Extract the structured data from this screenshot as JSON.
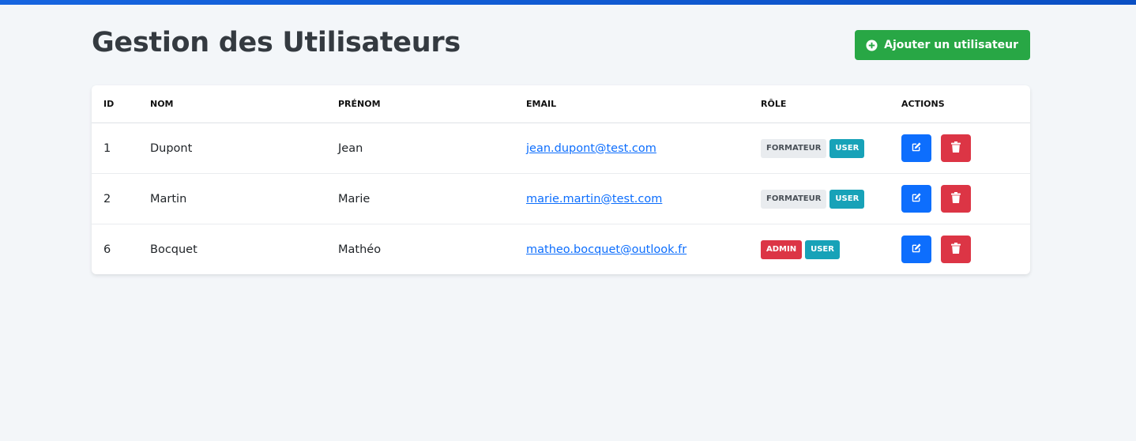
{
  "header": {
    "title": "Gestion des Utilisateurs",
    "add_button_label": "Ajouter un utilisateur"
  },
  "table": {
    "columns": [
      "ID",
      "NOM",
      "PRÉNOM",
      "EMAIL",
      "RÔLE",
      "ACTIONS"
    ],
    "rows": [
      {
        "id": "1",
        "nom": "Dupont",
        "prenom": "Jean",
        "email": "jean.dupont@test.com",
        "roles": [
          "FORMATEUR",
          "USER"
        ]
      },
      {
        "id": "2",
        "nom": "Martin",
        "prenom": "Marie",
        "email": "marie.martin@test.com",
        "roles": [
          "FORMATEUR",
          "USER"
        ]
      },
      {
        "id": "6",
        "nom": "Bocquet",
        "prenom": "Mathéo",
        "email": "matheo.bocquet@outlook.fr",
        "roles": [
          "ADMIN",
          "USER"
        ]
      }
    ]
  },
  "icons": {
    "add": "plus-circle-icon",
    "edit": "edit-icon",
    "delete": "trash-icon"
  },
  "colors": {
    "success": "#28a745",
    "primary": "#0d6efd",
    "danger": "#dc3545",
    "info": "#17a2b8",
    "light": "#e9ecef"
  }
}
